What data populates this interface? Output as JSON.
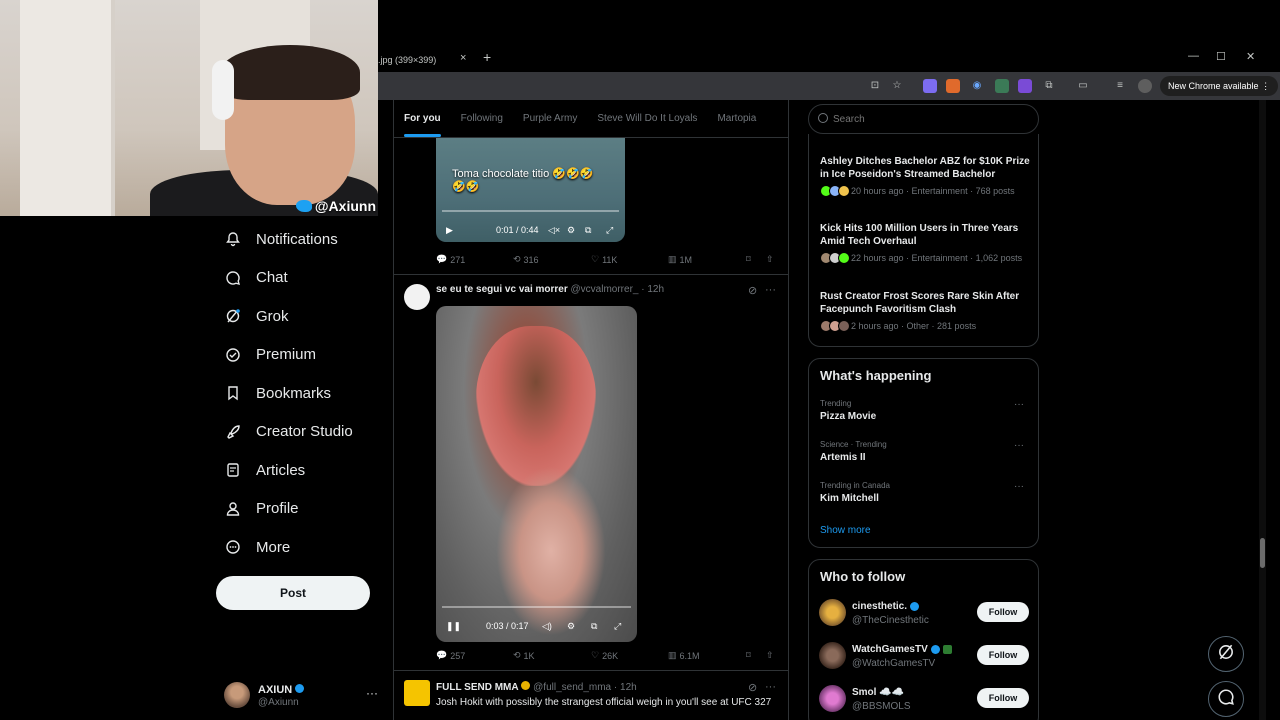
{
  "browser": {
    "tab_title": ".jpg (399×399)",
    "tab_close": "×",
    "new_tab": "+",
    "chrome_badge": "New Chrome available",
    "menu": "⋮",
    "minimize": "—",
    "maximize": "☐",
    "close": "✕"
  },
  "webcam": {
    "tag": "@Axiunn"
  },
  "nav": {
    "items": [
      {
        "label": "Notifications",
        "icon": "bell-icon"
      },
      {
        "label": "Chat",
        "icon": "chat-icon"
      },
      {
        "label": "Grok",
        "icon": "grok-icon"
      },
      {
        "label": "Premium",
        "icon": "premium-icon"
      },
      {
        "label": "Bookmarks",
        "icon": "bookmark-icon"
      },
      {
        "label": "Creator Studio",
        "icon": "rocket-icon"
      },
      {
        "label": "Articles",
        "icon": "articles-icon"
      },
      {
        "label": "Profile",
        "icon": "profile-icon"
      },
      {
        "label": "More",
        "icon": "more-circle-icon"
      }
    ],
    "post_button": "Post",
    "account": {
      "name": "AXIUN",
      "handle": "@Axiunn",
      "more": "···"
    }
  },
  "feed": {
    "tabs": [
      "For you",
      "Following",
      "Purple Army",
      "Steve Will Do It Loyals",
      "Martopia"
    ],
    "active_tab": "For you",
    "post1": {
      "time": "0:01 / 0:44",
      "replies": "271",
      "reposts": "316",
      "likes": "11K",
      "views": "1M"
    },
    "post2": {
      "name": "se eu te segui vc vai morrer",
      "handle": "@vcvalmorrer_",
      "time_ago": "· 12h",
      "caption": "Toma chocolate titio 🤣🤣🤣🤣🤣",
      "time": "0:03 / 0:17",
      "replies": "257",
      "reposts": "1K",
      "likes": "26K",
      "views": "6.1M"
    },
    "post3": {
      "name": "FULL SEND MMA",
      "handle": "@full_send_mma",
      "time_ago": "· 12h",
      "text": "Josh Hokit with possibly the strangest official weigh in you'll see at UFC 327"
    },
    "more": "···"
  },
  "sidebar": {
    "search_placeholder": "Search",
    "news": [
      {
        "title": "Ashley Ditches Bachelor ABZ for $10K Prize in Ice Poseidon's Streamed Bachelor",
        "meta": "20 hours ago · Entertainment · 768 posts"
      },
      {
        "title": "Kick Hits 100 Million Users in Three Years Amid Tech Overhaul",
        "meta": "22 hours ago · Entertainment · 1,062 posts"
      },
      {
        "title": "Rust Creator Frost Scores Rare Skin After Facepunch Favoritism Clash",
        "meta": "2 hours ago · Other · 281 posts"
      }
    ],
    "happening": {
      "title": "What's happening",
      "trends": [
        {
          "category": "Trending",
          "name": "Pizza Movie"
        },
        {
          "category": "Science · Trending",
          "name": "Artemis II"
        },
        {
          "category": "Trending in Canada",
          "name": "Kim Mitchell"
        }
      ],
      "show_more": "Show more",
      "more": "···"
    },
    "who_to_follow": {
      "title": "Who to follow",
      "accounts": [
        {
          "name": "cinesthetic.",
          "handle": "@TheCinesthetic",
          "button": "Follow"
        },
        {
          "name": "WatchGamesTV",
          "handle": "@WatchGamesTV",
          "button": "Follow"
        },
        {
          "name": "Smol ☁️☁️",
          "handle": "@BBSMOLS",
          "button": "Follow"
        }
      ]
    }
  },
  "colors": {
    "accent": "#1d9bf0",
    "background": "#000000",
    "muted": "#71767b"
  }
}
